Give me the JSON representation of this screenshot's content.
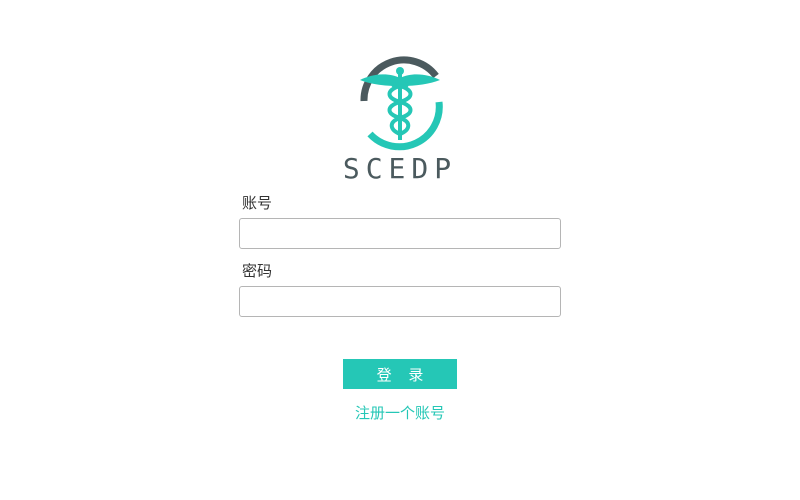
{
  "brand": {
    "name": "SCEDP",
    "logo_icon": "caduceus-icon",
    "colors": {
      "accent": "#25c7b6",
      "dark": "#4b5a5e"
    }
  },
  "form": {
    "account_label": "账号",
    "account_value": "",
    "password_label": "密码",
    "password_value": ""
  },
  "actions": {
    "login_label": "登 录",
    "register_label": "注册一个账号"
  }
}
